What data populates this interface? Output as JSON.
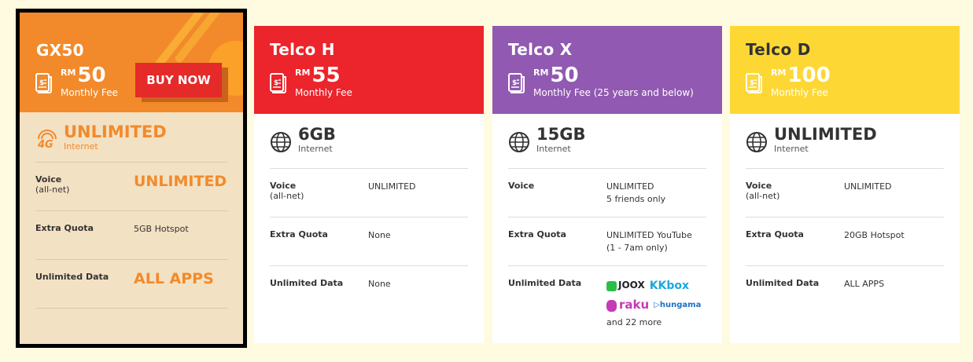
{
  "cards": [
    {
      "name": "GX50",
      "rm": "RM",
      "amount": "50",
      "fee": "Monthly Fee",
      "buy_label": "BUY NOW",
      "internet": "UNLIMITED",
      "internet_sub": "Internet",
      "voice_label": "Voice",
      "voice_sub": "(all-net)",
      "voice": "UNLIMITED",
      "extra_label": "Extra Quota",
      "extra": "5GB Hotspot",
      "unlimited_label": "Unlimited Data",
      "unlimited": "ALL APPS"
    },
    {
      "name": "Telco H",
      "rm": "RM",
      "amount": "55",
      "fee": "Monthly Fee",
      "internet": "6GB",
      "internet_sub": "Internet",
      "voice_label": "Voice",
      "voice_sub": "(all-net)",
      "voice": "UNLIMITED",
      "extra_label": "Extra Quota",
      "extra": "None",
      "unlimited_label": "Unlimited Data",
      "unlimited": "None"
    },
    {
      "name": "Telco X",
      "rm": "RM",
      "amount": "50",
      "fee": "Monthly Fee (25 years and below)",
      "internet": "15GB",
      "internet_sub": "Internet",
      "voice_label": "Voice",
      "voice": "UNLIMITED",
      "voice_note": "5 friends only",
      "extra_label": "Extra Quota",
      "extra": "UNLIMITED YouTube",
      "extra_note": "(1 - 7am only)",
      "unlimited_label": "Unlimited Data",
      "logos": [
        "JOOX",
        "KKbox",
        "raku",
        "hungama"
      ],
      "unlimited_more": "and 22 more"
    },
    {
      "name": "Telco D",
      "rm": "RM",
      "amount": "100",
      "fee": "Monthly Fee",
      "internet": "UNLIMITED",
      "internet_sub": "Internet",
      "voice_label": "Voice",
      "voice_sub": "(all-net)",
      "voice": "UNLIMITED",
      "extra_label": "Extra Quota",
      "extra": "20GB Hotspot",
      "unlimited_label": "Unlimited Data",
      "unlimited": "ALL APPS"
    }
  ],
  "colors": {
    "gx_header": "#f28a2b",
    "telco_h": "#ec242b",
    "telco_x": "#9159b1",
    "telco_d": "#fdd835",
    "buy_button": "#e52a2a"
  },
  "icons": [
    "bill-icon",
    "globe-icon",
    "4g-icon"
  ]
}
